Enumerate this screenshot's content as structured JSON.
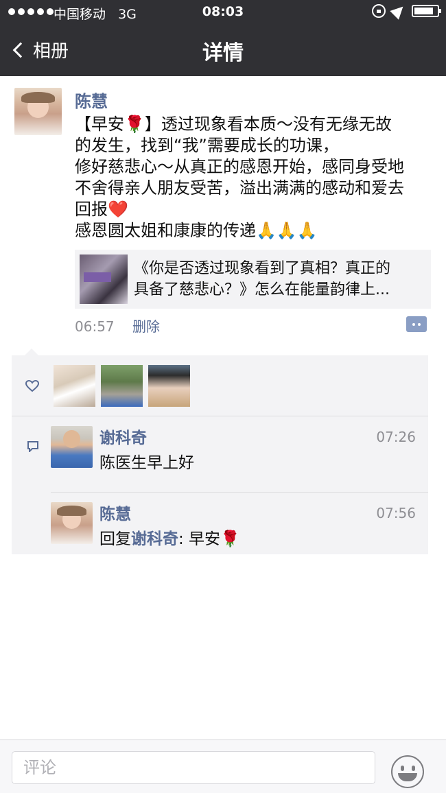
{
  "status_bar": {
    "carrier": "中国移动",
    "network": "3G",
    "time": "08:03",
    "battery_level": 0.75
  },
  "nav": {
    "back_label": "相册",
    "title": "详情"
  },
  "post": {
    "author": "陈慧",
    "lines": [
      "【早安🌹】透过现象看本质～没有无缘无故",
      "的发生，找到“我”需要成长的功课，",
      "修好慈悲心～从真正的感恩开始，感同身受地",
      "不舍得亲人朋友受苦，溢出满满的感动和爱去",
      "回报❤️",
      "感恩圆太姐和康康的传递🙏🙏🙏"
    ],
    "link_card": {
      "line1": "《你是否透过现象看到了真相？真正的",
      "line2": "具备了慈悲心？》怎么在能量韵律上..."
    },
    "time": "06:57",
    "delete_label": "删除"
  },
  "comments": [
    {
      "name": "谢科奇",
      "time": "07:26",
      "text": "陈医生早上好"
    },
    {
      "name": "陈慧",
      "time": "07:56",
      "reply_prefix": "回复",
      "reply_to": "谢科奇",
      "text": ": 早安🌹"
    }
  ],
  "comment_bar": {
    "placeholder": "评论"
  },
  "colors": {
    "nav_bg": "#303034",
    "link": "#576b95",
    "panel_bg": "#f3f3f5"
  },
  "icons": {
    "like": "heart-icon",
    "comment": "comment-icon",
    "emoji": "smiley-icon",
    "back": "chevron-left-icon"
  }
}
